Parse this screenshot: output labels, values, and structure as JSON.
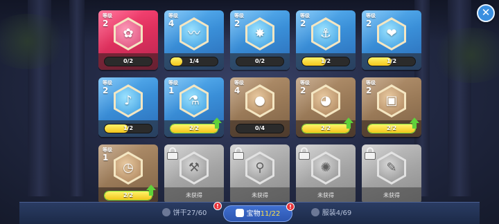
{
  "close_label": "✕",
  "level_label": "等级",
  "locked_label": "未获得",
  "tabs": [
    {
      "name": "cookies",
      "label": "饼干",
      "count": "27/60",
      "badge": "!",
      "icon": "cookie-icon"
    },
    {
      "name": "treasures",
      "label": "宝物",
      "count": "11/22",
      "badge": "!",
      "icon": "treasure-icon"
    },
    {
      "name": "costumes",
      "label": "服装",
      "count": "4/69",
      "icon": "shirt-icon"
    }
  ],
  "cards": [
    {
      "rarity": "red",
      "level": "2",
      "progress": "0/2",
      "fill": 0,
      "icon": "flower-icon",
      "glyph": "✿"
    },
    {
      "rarity": "blue",
      "level": "4",
      "progress": "1/4",
      "fill": 0.25,
      "icon": "horn-icon",
      "glyph": "〰"
    },
    {
      "rarity": "blue",
      "level": "2",
      "progress": "0/2",
      "fill": 0,
      "icon": "crystal-icon",
      "glyph": "✸"
    },
    {
      "rarity": "blue",
      "level": "2",
      "progress": "1/2",
      "fill": 0.5,
      "icon": "hook-icon",
      "glyph": "⚓"
    },
    {
      "rarity": "blue",
      "level": "2",
      "progress": "1/2",
      "fill": 0.5,
      "icon": "candy-icon",
      "glyph": "❤"
    },
    {
      "rarity": "blue",
      "level": "2",
      "progress": "1/2",
      "fill": 0.5,
      "icon": "whistle-icon",
      "glyph": "♪"
    },
    {
      "rarity": "blue",
      "level": "1",
      "progress": "2/2",
      "fill": 1,
      "ready": true,
      "icon": "potion-icon",
      "glyph": "⚗"
    },
    {
      "rarity": "brown",
      "level": "4",
      "progress": "0/4",
      "fill": 0,
      "icon": "pumpkin-icon",
      "glyph": "●"
    },
    {
      "rarity": "brown",
      "level": "2",
      "progress": "2/2",
      "fill": 1,
      "ready": true,
      "icon": "shell-icon",
      "glyph": "◕"
    },
    {
      "rarity": "brown",
      "level": "2",
      "progress": "2/2",
      "fill": 1,
      "ready": true,
      "icon": "chest-icon",
      "glyph": "▣"
    },
    {
      "rarity": "brown",
      "level": "1",
      "progress": "2/2",
      "fill": 1,
      "ready": true,
      "icon": "clock-icon",
      "glyph": "◷"
    },
    {
      "rarity": "gray",
      "locked": true,
      "icon": "hammer-icon",
      "glyph": "⚒"
    },
    {
      "rarity": "gray",
      "locked": true,
      "icon": "magnifier-icon",
      "glyph": "⚲"
    },
    {
      "rarity": "gray",
      "locked": true,
      "icon": "pot-icon",
      "glyph": "✺"
    },
    {
      "rarity": "gray",
      "locked": true,
      "icon": "bone-icon",
      "glyph": "✎"
    }
  ]
}
